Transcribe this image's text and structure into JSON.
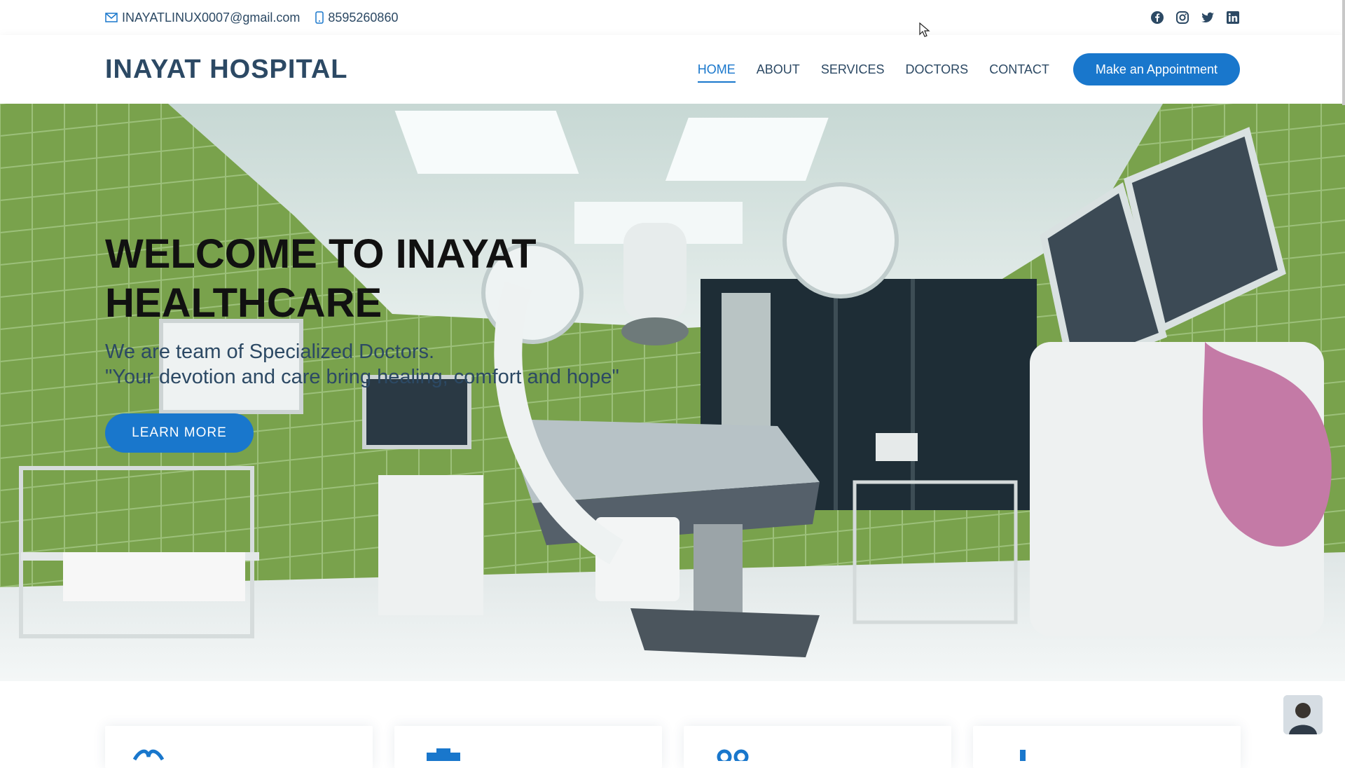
{
  "topbar": {
    "email": "INAYATLINUX0007@gmail.com",
    "phone": "8595260860",
    "social": [
      "facebook-icon",
      "instagram-icon",
      "twitter-icon",
      "linkedin-icon"
    ]
  },
  "header": {
    "logo": "INAYAT HOSPITAL",
    "nav": [
      "HOME",
      "ABOUT",
      "SERVICES",
      "DOCTORS",
      "CONTACT"
    ],
    "active_nav": "HOME",
    "cta": "Make an Appointment"
  },
  "hero": {
    "title": "WELCOME TO INAYAT HEALTHCARE",
    "subtitle_line1": "We are team of Specialized Doctors.",
    "subtitle_line2": "\"Your devotion and care bring healing, comfort and hope\"",
    "button": "LEARN MORE"
  },
  "colors": {
    "accent": "#1977cc",
    "text": "#2c4964",
    "hero_wall": "#7aa34d"
  }
}
